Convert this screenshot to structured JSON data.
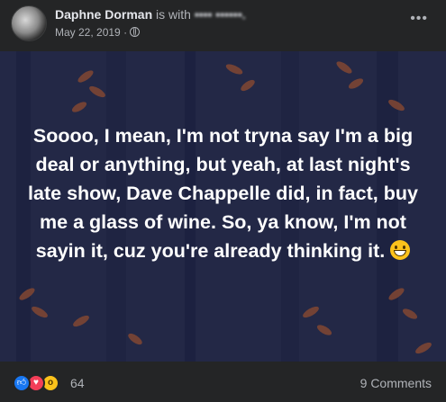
{
  "header": {
    "author": "Daphne Dorman",
    "with_text": "is with",
    "tagged": "•••• ••••••.",
    "date": "May 22, 2019",
    "separator": "·",
    "more_label": "•••",
    "privacy_icon": "globe-icon"
  },
  "post": {
    "text": "Soooo, I mean, I'm not tryna say I'm a big deal or anything, but yeah, at last night's late show, Dave Chappelle did, in fact, buy me a glass of wine. So, ya know, I'm not sayin it, cuz you're already thinking it.",
    "emoji": "grinning-face-sweat-icon",
    "background_color": "#232846"
  },
  "footer": {
    "reaction_icons": [
      "like-icon",
      "love-icon",
      "wow-icon"
    ],
    "reaction_count": "64",
    "comments_label": "9 Comments"
  },
  "colors": {
    "surface": "#242526",
    "text_primary": "#e4e6eb",
    "text_secondary": "#b0b3b8",
    "like": "#1877f2",
    "love": "#f33e58",
    "wow": "#fcc21b",
    "leaf": "#8a4a34"
  }
}
